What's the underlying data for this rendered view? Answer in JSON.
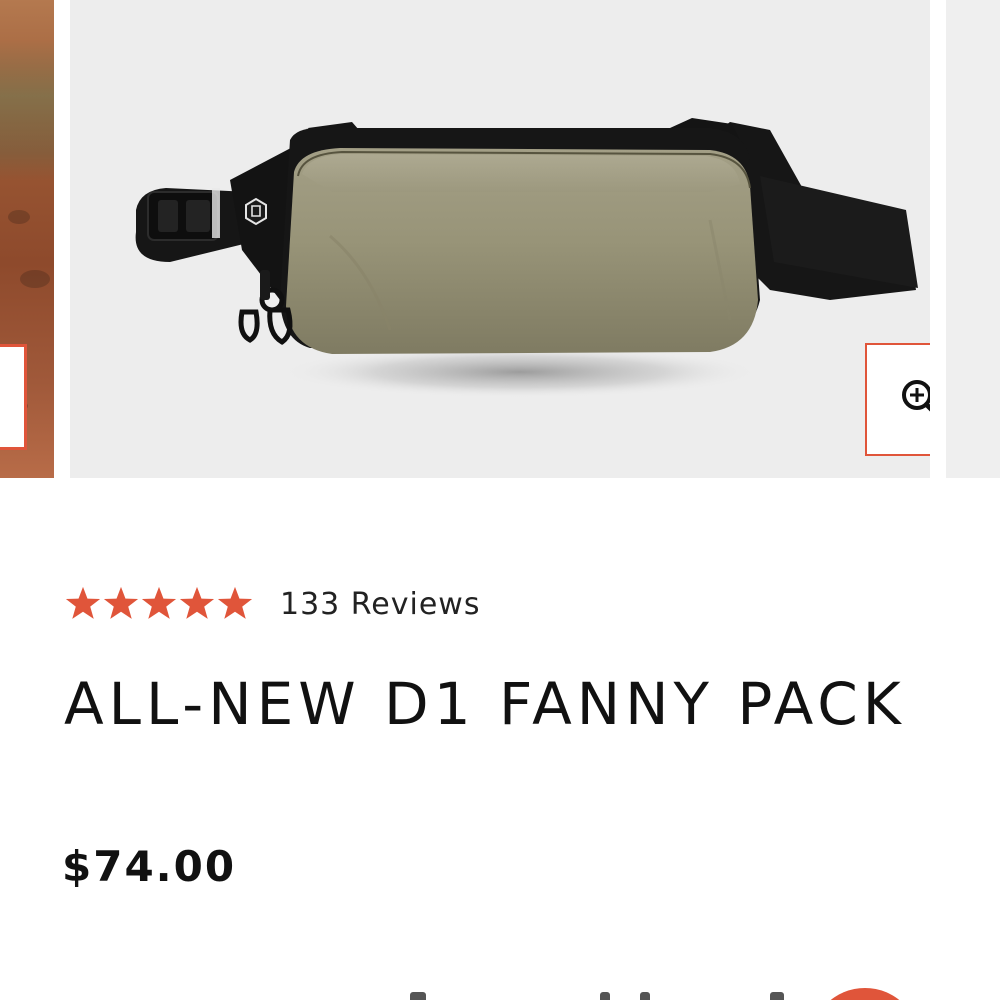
{
  "gallery": {
    "current_slide_alt": "All-New D1 Fanny Pack in olive",
    "zoom_icon": "zoom-in-icon"
  },
  "product": {
    "rating": {
      "stars": 5,
      "max_stars": 5,
      "star_color": "#e0553a",
      "reviews_label": "133 Reviews"
    },
    "title": "ALL-NEW D1 FANNY PACK",
    "price": "$74.00"
  },
  "colors": {
    "accent": "#e0553a",
    "text": "#111111",
    "image_bg": "#ededed"
  }
}
